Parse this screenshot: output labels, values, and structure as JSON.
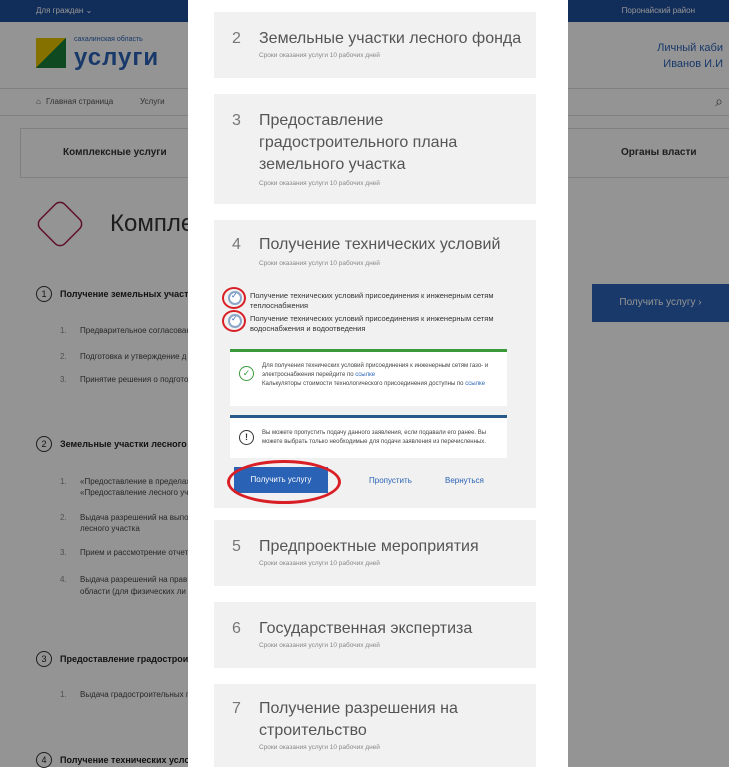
{
  "bg": {
    "top_left": "Для граждан",
    "top_right": "Поронайский район",
    "logo_region": "сахалинская область",
    "logo_name": "услуги",
    "cabinet_line1": "Личный каби",
    "cabinet_line2": "Иванов И.И",
    "crumb_home": "Главная страница",
    "crumb_services": "Услуги",
    "tab_complex": "Комплексные услуги",
    "tab_authorities": "Органы власти",
    "page_title": "Комплек",
    "sections": [
      {
        "num": "1",
        "label": "Получение земельных участ"
      },
      {
        "num": "2",
        "label": "Земельные участки лесного ф"
      },
      {
        "num": "3",
        "label": "Предоставление градостроит"
      },
      {
        "num": "4",
        "label": "Получение технических услов"
      }
    ],
    "subs": [
      {
        "num": "1.",
        "label": "Предварительное согласован"
      },
      {
        "num": "2.",
        "label": "Подготовка и утверждение д"
      },
      {
        "num": "3.",
        "label": "Принятие решения о подгото"
      },
      {
        "num": "1.",
        "label": "«Предоставление в пределах"
      },
      {
        "num": "",
        "label": "«Предоставление лесного уча"
      },
      {
        "num": "2.",
        "label": "Выдача разрешений на выпол"
      },
      {
        "num": "",
        "label": "лесного участка"
      },
      {
        "num": "3.",
        "label": "Прием и рассмотрение отчет"
      },
      {
        "num": "4.",
        "label": "Выдача разрешений на прав"
      },
      {
        "num": "",
        "label": "области (для физических ли"
      },
      {
        "num": "1.",
        "label": "Выдача градостроительных п"
      }
    ],
    "get_button": "Получить услугу ›"
  },
  "modal": {
    "cards": [
      {
        "num": "2",
        "title": "Земельные участки лесного фонда",
        "term": "Сроки оказания услуги 10 рабочих дней"
      },
      {
        "num": "3",
        "title": "Предоставление градостроительного плана земельного участка",
        "term": "Сроки оказания услуги 10 рабочих дней"
      },
      {
        "num": "4",
        "title": "Получение технических условий",
        "term": "Сроки оказания услуги 10 рабочих дней"
      },
      {
        "num": "5",
        "title": "Предпроектные мероприятия",
        "term": "Сроки оказания услуги 10 рабочих дней"
      },
      {
        "num": "6",
        "title": "Государственная экспертиза",
        "term": "Сроки оказания услуги 10 рабочих дней"
      },
      {
        "num": "7",
        "title": "Получение разрешения на строительство",
        "term": "Сроки оказания услуги 10 рабочих дней"
      }
    ],
    "checks": [
      "Получение технических условий присоединения к инженерным сетям теплоснабжения",
      "Получение технических условий присоединения к инженерным сетям водоснабжения и водоотведения"
    ],
    "info_green": {
      "text1": "Для получения технических условий присоединения к инженерным сетям газо- и электроснабжения перейдите по",
      "link1": "ссылке",
      "text2": "Калькуляторы стоимости технологического присоединения доступны по",
      "link2": "ссылке"
    },
    "info_blue": {
      "text": "Вы можете пропустить подачу данного заявления, если подавали его ранее. Вы можете выбрать только необходимые для подачи заявления из перечисленных."
    },
    "btn_get": "Получить услугу",
    "btn_skip": "Пропустить",
    "btn_back": "Вернуться"
  },
  "colors": {
    "accent": "#2a63b5",
    "highlight": "#d91f26",
    "success": "#3a9a3a",
    "card_bg": "#f1f1f1"
  }
}
